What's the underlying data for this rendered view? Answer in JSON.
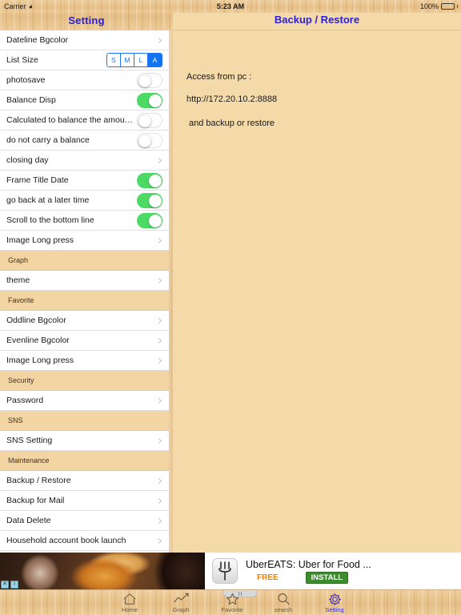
{
  "status_bar": {
    "carrier": "Carrier",
    "wifi_icon": "wifi-icon",
    "time": "5:23 AM",
    "battery": "100%"
  },
  "master": {
    "title": "Setting",
    "sections": [
      {
        "header": null,
        "rows": [
          {
            "label": "Dateline Bgcolor",
            "type": "disclosure"
          },
          {
            "label": "List Size",
            "type": "segmented",
            "options": [
              "S",
              "M",
              "L",
              "A"
            ],
            "selected": "A"
          },
          {
            "label": "photosave",
            "type": "toggle",
            "value": "off"
          },
          {
            "label": "Balance Disp",
            "type": "toggle",
            "value": "on"
          },
          {
            "label": "Calculated to balance the amou…",
            "type": "toggle",
            "value": "off"
          },
          {
            "label": "do not carry a balance",
            "type": "toggle",
            "value": "off"
          },
          {
            "label": "closing day",
            "type": "disclosure"
          },
          {
            "label": "Frame Title Date",
            "type": "toggle",
            "value": "on"
          },
          {
            "label": "go back at a later time",
            "type": "toggle",
            "value": "on"
          },
          {
            "label": "Scroll to the bottom line",
            "type": "toggle",
            "value": "on"
          },
          {
            "label": "Image Long press",
            "type": "disclosure"
          }
        ]
      },
      {
        "header": "Graph",
        "rows": [
          {
            "label": "theme",
            "type": "disclosure"
          }
        ]
      },
      {
        "header": "Favorite",
        "rows": [
          {
            "label": "Oddline Bgcolor",
            "type": "disclosure"
          },
          {
            "label": "Evenline Bgcolor",
            "type": "disclosure"
          },
          {
            "label": "Image Long press",
            "type": "disclosure"
          }
        ]
      },
      {
        "header": "Security",
        "rows": [
          {
            "label": "Password",
            "type": "disclosure"
          }
        ]
      },
      {
        "header": "SNS",
        "rows": [
          {
            "label": "SNS Setting",
            "type": "disclosure"
          }
        ]
      },
      {
        "header": "Maintenance",
        "rows": [
          {
            "label": "Backup / Restore",
            "type": "disclosure"
          },
          {
            "label": "Backup for Mail",
            "type": "disclosure"
          },
          {
            "label": "Data Delete",
            "type": "disclosure"
          },
          {
            "label": "Household account book launch",
            "type": "disclosure"
          }
        ]
      }
    ]
  },
  "detail": {
    "title": "Backup / Restore",
    "line1": "Access from pc :",
    "line2": "http://172.20.10.2:8888",
    "line3": "and backup or restore"
  },
  "ad": {
    "icon": "fork-icon",
    "title": "UberEATS: Uber for Food ...",
    "price_label": "FREE",
    "install_label": "INSTALL",
    "close_label": "✕",
    "info_label": "i"
  },
  "tabbar": {
    "items": [
      {
        "label": "Home",
        "icon": "home-icon",
        "active": false
      },
      {
        "label": "Graph",
        "icon": "chart-line-icon",
        "active": false
      },
      {
        "label": "Favorite",
        "icon": "star-icon",
        "active": false
      },
      {
        "label": "search",
        "icon": "search-icon",
        "active": false
      },
      {
        "label": "Setting",
        "icon": "gear-icon",
        "active": true
      }
    ]
  },
  "colors": {
    "accent_blue": "#2b21d8",
    "toggle_on": "#4cd964",
    "segment_blue": "#1272f0",
    "wood": "#e8c28d",
    "detail_bg": "#f4d9a9",
    "section_header_bg": "#f3d5a4",
    "install_green": "#3d8b2f",
    "free_orange": "#e8820c"
  }
}
